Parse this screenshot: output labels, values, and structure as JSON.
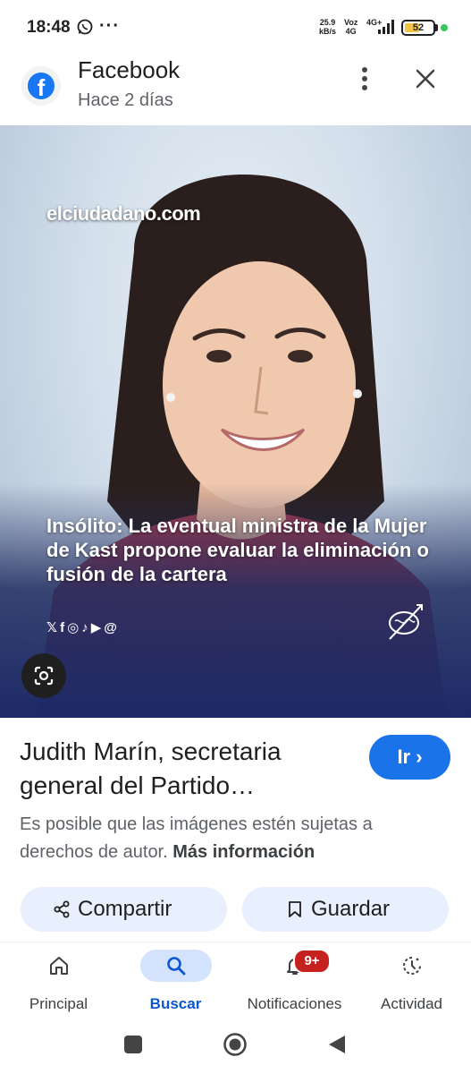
{
  "status_bar": {
    "time": "18:48",
    "dots": "···",
    "net_speed_value": "25.9",
    "net_speed_unit": "kB/s",
    "volte_top": "Voz",
    "volte_bottom": "4G",
    "lte": "4G+",
    "battery": "52"
  },
  "header": {
    "source": "Facebook",
    "time_ago": "Hace 2 días",
    "logo_letter": "f"
  },
  "image": {
    "watermark": "elciudadano.com",
    "headline": "Insólito: La eventual ministra de la Mujer de Kast propone evaluar la eliminación o fusión de la cartera",
    "social": [
      "𝕏",
      "f",
      "◎",
      "♪",
      "▶",
      "@"
    ]
  },
  "result": {
    "title": "Judith Marín, secretaria general del Partido…",
    "go_label": "Ir ›",
    "copyright_text": "Es posible que las imágenes estén sujetas a derechos de autor.",
    "more_info": "Más información"
  },
  "actions": {
    "share": "Compartir",
    "save": "Guardar"
  },
  "bottom_nav": {
    "items": [
      {
        "label": "Principal",
        "icon": "home-icon"
      },
      {
        "label": "Buscar",
        "icon": "search-icon",
        "active": true
      },
      {
        "label": "Notificaciones",
        "icon": "bell-icon",
        "badge": "9+"
      },
      {
        "label": "Actividad",
        "icon": "activity-icon"
      }
    ]
  },
  "colors": {
    "accent": "#1a73e8",
    "chip_bg": "#e8f0fe",
    "active_nav": "#d3e3fd",
    "badge": "#c5221f",
    "facebook": "#1877f2"
  }
}
